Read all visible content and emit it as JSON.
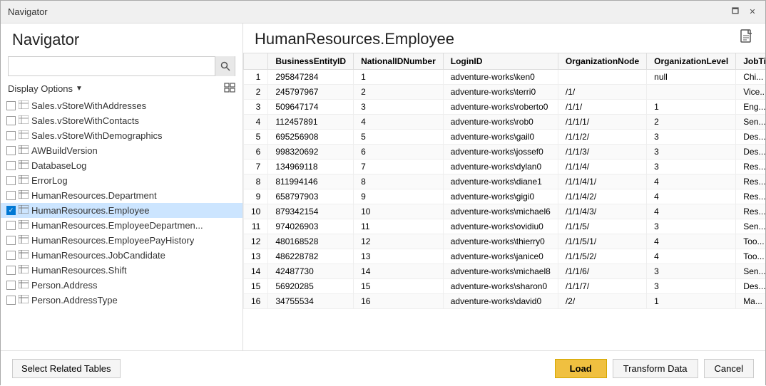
{
  "titleBar": {
    "title": "Navigator",
    "minimizeLabel": "🗖",
    "closeLabel": "✕"
  },
  "leftPanel": {
    "appTitle": "Navigator",
    "search": {
      "placeholder": "",
      "value": ""
    },
    "displayOptions": {
      "label": "Display Options",
      "arrow": "▼"
    },
    "navItems": [
      {
        "id": 1,
        "label": "Sales.vStoreWithAddresses",
        "checked": false,
        "selected": false,
        "type": "view"
      },
      {
        "id": 2,
        "label": "Sales.vStoreWithContacts",
        "checked": false,
        "selected": false,
        "type": "view"
      },
      {
        "id": 3,
        "label": "Sales.vStoreWithDemographics",
        "checked": false,
        "selected": false,
        "type": "view"
      },
      {
        "id": 4,
        "label": "AWBuildVersion",
        "checked": false,
        "selected": false,
        "type": "table"
      },
      {
        "id": 5,
        "label": "DatabaseLog",
        "checked": false,
        "selected": false,
        "type": "table"
      },
      {
        "id": 6,
        "label": "ErrorLog",
        "checked": false,
        "selected": false,
        "type": "table"
      },
      {
        "id": 7,
        "label": "HumanResources.Department",
        "checked": false,
        "selected": false,
        "type": "table"
      },
      {
        "id": 8,
        "label": "HumanResources.Employee",
        "checked": true,
        "selected": true,
        "type": "table"
      },
      {
        "id": 9,
        "label": "HumanResources.EmployeeDepartmen...",
        "checked": false,
        "selected": false,
        "type": "table"
      },
      {
        "id": 10,
        "label": "HumanResources.EmployeePayHistory",
        "checked": false,
        "selected": false,
        "type": "table"
      },
      {
        "id": 11,
        "label": "HumanResources.JobCandidate",
        "checked": false,
        "selected": false,
        "type": "table"
      },
      {
        "id": 12,
        "label": "HumanResources.Shift",
        "checked": false,
        "selected": false,
        "type": "table"
      },
      {
        "id": 13,
        "label": "Person.Address",
        "checked": false,
        "selected": false,
        "type": "table"
      },
      {
        "id": 14,
        "label": "Person.AddressType",
        "checked": false,
        "selected": false,
        "type": "table"
      }
    ]
  },
  "rightPanel": {
    "previewTitle": "HumanResources.Employee",
    "columns": [
      "BusinessEntityID",
      "NationalIDNumber",
      "LoginID",
      "OrganizationNode",
      "OrganizationLevel",
      "JobTitl..."
    ],
    "rows": [
      {
        "row": 1,
        "BusinessEntityID": "295847284",
        "NationalIDNumber": "1",
        "LoginID": "adventure-works\\ken0",
        "OrganizationNode": "",
        "OrganizationLevel": "null",
        "JobTitle": "Chi..."
      },
      {
        "row": 2,
        "BusinessEntityID": "245797967",
        "NationalIDNumber": "2",
        "LoginID": "adventure-works\\terri0",
        "OrganizationNode": "/1/",
        "OrganizationLevel": "",
        "JobTitle": "Vice..."
      },
      {
        "row": 3,
        "BusinessEntityID": "509647174",
        "NationalIDNumber": "3",
        "LoginID": "adventure-works\\roberto0",
        "OrganizationNode": "/1/1/",
        "OrganizationLevel": "1",
        "JobTitle": "Eng..."
      },
      {
        "row": 4,
        "BusinessEntityID": "112457891",
        "NationalIDNumber": "4",
        "LoginID": "adventure-works\\rob0",
        "OrganizationNode": "/1/1/1/",
        "OrganizationLevel": "2",
        "JobTitle": "Sen..."
      },
      {
        "row": 5,
        "BusinessEntityID": "695256908",
        "NationalIDNumber": "5",
        "LoginID": "adventure-works\\gail0",
        "OrganizationNode": "/1/1/2/",
        "OrganizationLevel": "3",
        "JobTitle": "Des..."
      },
      {
        "row": 6,
        "BusinessEntityID": "998320692",
        "NationalIDNumber": "6",
        "LoginID": "adventure-works\\jossef0",
        "OrganizationNode": "/1/1/3/",
        "OrganizationLevel": "3",
        "JobTitle": "Des..."
      },
      {
        "row": 7,
        "BusinessEntityID": "134969118",
        "NationalIDNumber": "7",
        "LoginID": "adventure-works\\dylan0",
        "OrganizationNode": "/1/1/4/",
        "OrganizationLevel": "3",
        "JobTitle": "Res..."
      },
      {
        "row": 8,
        "BusinessEntityID": "811994146",
        "NationalIDNumber": "8",
        "LoginID": "adventure-works\\diane1",
        "OrganizationNode": "/1/1/4/1/",
        "OrganizationLevel": "4",
        "JobTitle": "Res..."
      },
      {
        "row": 9,
        "BusinessEntityID": "658797903",
        "NationalIDNumber": "9",
        "LoginID": "adventure-works\\gigi0",
        "OrganizationNode": "/1/1/4/2/",
        "OrganizationLevel": "4",
        "JobTitle": "Res..."
      },
      {
        "row": 10,
        "BusinessEntityID": "879342154",
        "NationalIDNumber": "10",
        "LoginID": "adventure-works\\michael6",
        "OrganizationNode": "/1/1/4/3/",
        "OrganizationLevel": "4",
        "JobTitle": "Res..."
      },
      {
        "row": 11,
        "BusinessEntityID": "974026903",
        "NationalIDNumber": "11",
        "LoginID": "adventure-works\\ovidiu0",
        "OrganizationNode": "/1/1/5/",
        "OrganizationLevel": "3",
        "JobTitle": "Sen..."
      },
      {
        "row": 12,
        "BusinessEntityID": "480168528",
        "NationalIDNumber": "12",
        "LoginID": "adventure-works\\thierry0",
        "OrganizationNode": "/1/1/5/1/",
        "OrganizationLevel": "4",
        "JobTitle": "Too..."
      },
      {
        "row": 13,
        "BusinessEntityID": "486228782",
        "NationalIDNumber": "13",
        "LoginID": "adventure-works\\janice0",
        "OrganizationNode": "/1/1/5/2/",
        "OrganizationLevel": "4",
        "JobTitle": "Too..."
      },
      {
        "row": 14,
        "BusinessEntityID": "42487730",
        "NationalIDNumber": "14",
        "LoginID": "adventure-works\\michael8",
        "OrganizationNode": "/1/1/6/",
        "OrganizationLevel": "3",
        "JobTitle": "Sen..."
      },
      {
        "row": 15,
        "BusinessEntityID": "56920285",
        "NationalIDNumber": "15",
        "LoginID": "adventure-works\\sharon0",
        "OrganizationNode": "/1/1/7/",
        "OrganizationLevel": "3",
        "JobTitle": "Des..."
      },
      {
        "row": 16,
        "BusinessEntityID": "34755534",
        "NationalIDNumber": "16",
        "LoginID": "adventure-works\\david0",
        "OrganizationNode": "/2/",
        "OrganizationLevel": "1",
        "JobTitle": "Ma..."
      }
    ]
  },
  "bottomBar": {
    "selectRelatedLabel": "Select Related Tables",
    "loadLabel": "Load",
    "transformLabel": "Transform Data",
    "cancelLabel": "Cancel"
  }
}
